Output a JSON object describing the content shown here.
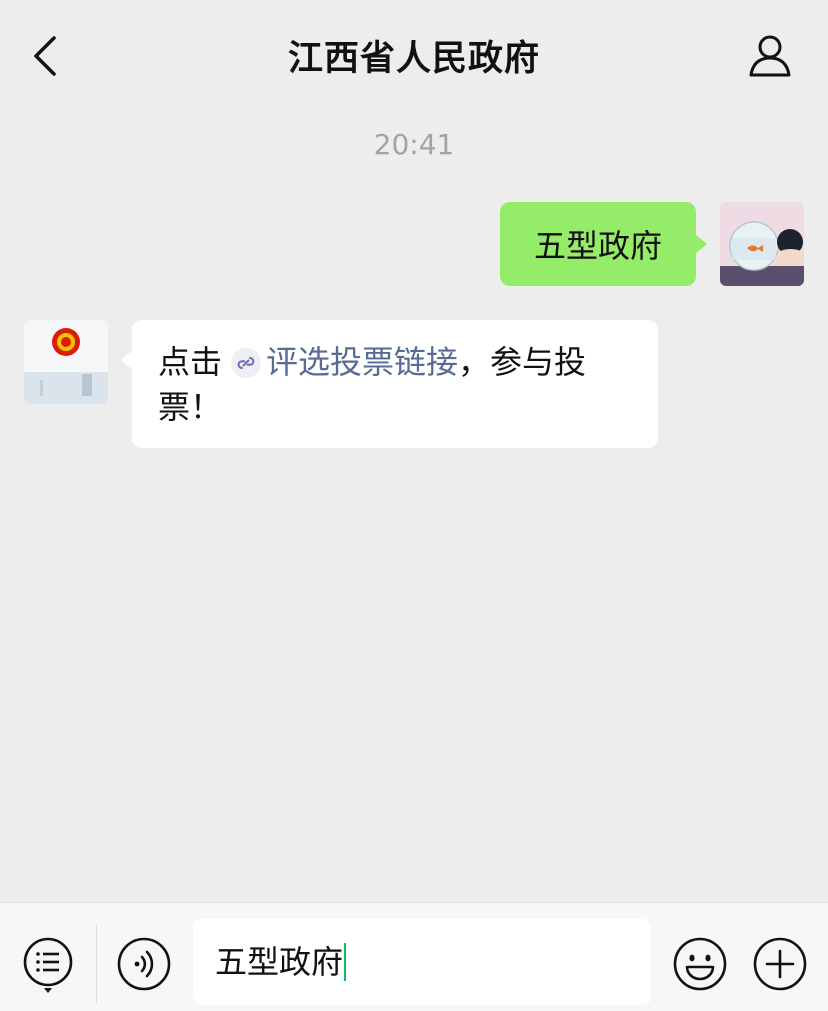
{
  "header": {
    "title": "江西省人民政府",
    "back_icon": "chevron-left-icon",
    "profile_icon": "person-icon"
  },
  "chat": {
    "timestamp": "20:41",
    "messages": [
      {
        "sender": "me",
        "text": "五型政府"
      },
      {
        "sender": "江西省人民政府",
        "avatar_caption": "江西省人民政府",
        "text_before": "点击",
        "link_text": "评选投票链接",
        "text_after": "，参与投票！"
      }
    ]
  },
  "input_bar": {
    "value": "五型政府",
    "menu_icon": "menu-list-icon",
    "voice_icon": "voice-icon",
    "emoji_icon": "emoji-icon",
    "plus_icon": "plus-icon"
  },
  "colors": {
    "background": "#ededed",
    "bubble_out": "#95ec69",
    "bubble_in": "#ffffff",
    "link": "#576b95",
    "emblem": "#d81e06"
  }
}
